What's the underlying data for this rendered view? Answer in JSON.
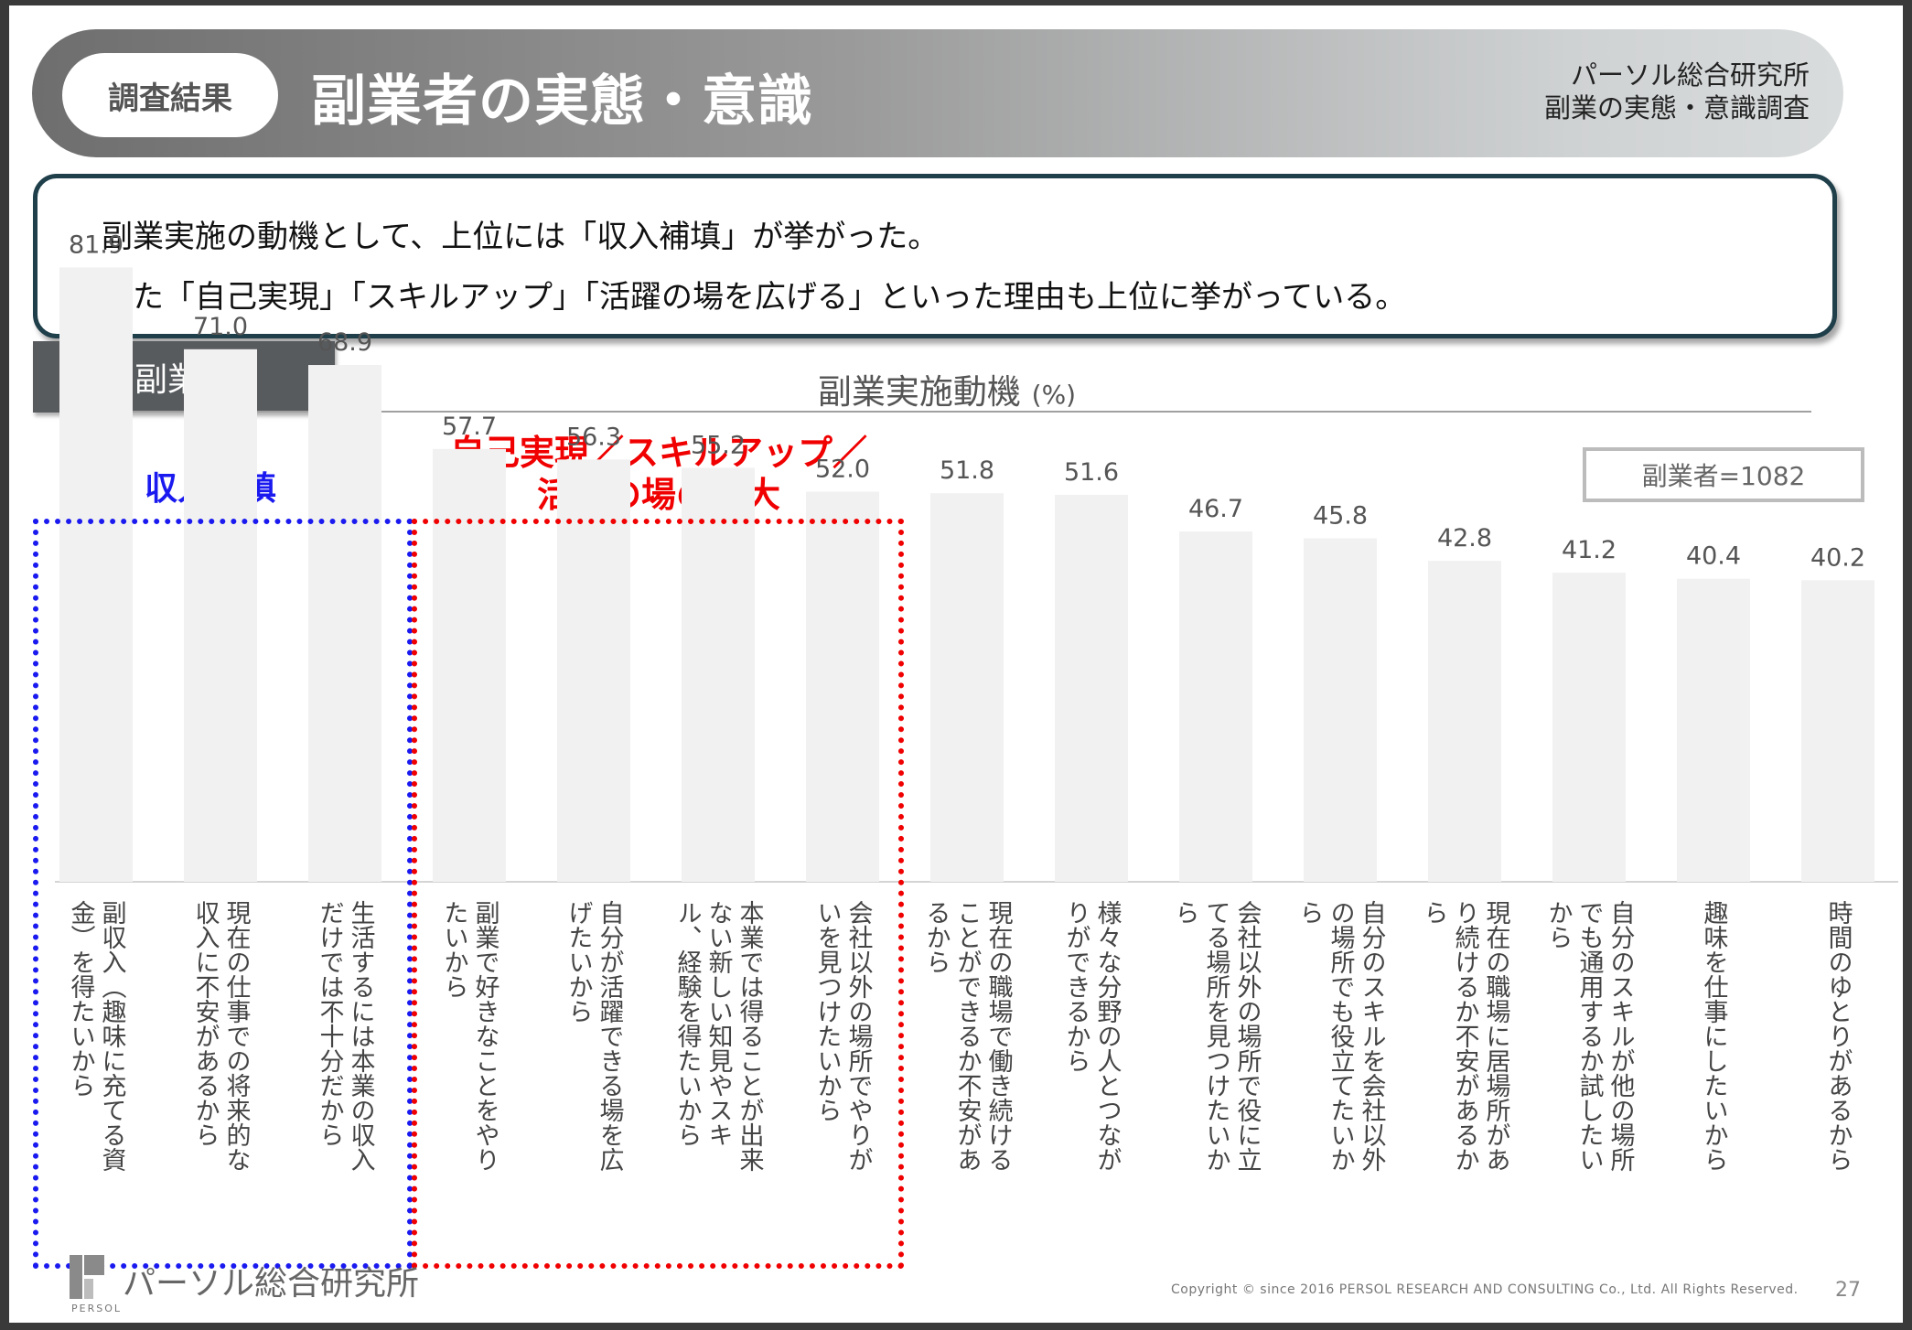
{
  "header": {
    "tag": "調査結果",
    "title": "副業者の実態・意識",
    "source_line1": "パーソル総合研究所",
    "source_line2": "副業の実態・意識調査"
  },
  "summary": {
    "line1": "副業実施の動機として、上位には「収入補填」が挙がった。",
    "line2": "また「自己実現」「スキルアップ」「活躍の場を広げる」といった理由も上位に挙がっている。"
  },
  "segment": "副業者",
  "sample": "副業者=1082",
  "groups": {
    "income": "収入補填",
    "self_line1": "自己実現／スキルアップ／",
    "self_line2": "活躍の場の拡大"
  },
  "colors": {
    "bar": "#f1f1f1",
    "income_group": "#1a1af0",
    "self_group": "#f00000"
  },
  "chart_data": {
    "type": "bar",
    "title": "副業実施動機",
    "unit": "(%)",
    "categories": [
      [
        "副収入（趣味に充てる資",
        "金）を得たいから"
      ],
      [
        "現在の仕事での将来的な",
        "収入に不安があるから"
      ],
      [
        "生活するには本業の収入",
        "だけでは不十分だから"
      ],
      [
        "副業で好きなことをやり",
        "たいから"
      ],
      [
        "自分が活躍できる場を広",
        "げたいから"
      ],
      [
        "本業では得ることが出来",
        "ない新しい知見やスキ",
        "ル、経験を得たいから"
      ],
      [
        "会社以外の場所でやりが",
        "いを見つけたいから"
      ],
      [
        "現在の職場で働き続ける",
        "ことができるか不安があ",
        "るから"
      ],
      [
        "様々な分野の人とつなが",
        "りができるから"
      ],
      [
        "会社以外の場所で役に立",
        "てる場所を見つけたいか",
        "ら"
      ],
      [
        "自分のスキルを会社以外",
        "の場所でも役立てたいか",
        "ら"
      ],
      [
        "現在の職場に居場所があ",
        "り続けるか不安があるか",
        "ら"
      ],
      [
        "自分のスキルが他の場所",
        "でも通用するか試したい",
        "から"
      ],
      [
        "趣味を仕事にしたいから"
      ],
      [
        "時間のゆとりがあるから"
      ]
    ],
    "values": [
      81.9,
      71.0,
      68.9,
      57.7,
      56.3,
      55.2,
      52.0,
      51.8,
      51.6,
      46.7,
      45.8,
      42.8,
      41.2,
      40.4,
      40.2
    ],
    "value_labels": [
      "81.9",
      "71.0",
      "68.9",
      "57.7",
      "56.3",
      "55.2",
      "52.0",
      "51.8",
      "51.6",
      "46.7",
      "45.8",
      "42.8",
      "41.2",
      "40.4",
      "40.2"
    ],
    "ylim": [
      0,
      100
    ],
    "grid": false,
    "legend": "none"
  },
  "footer": {
    "logo_text": "パーソル総合研究所",
    "logo_sub": "PERSOL",
    "copyright": "Copyright © since 2016 PERSOL RESEARCH AND CONSULTING Co., Ltd. All Rights Reserved.",
    "page": "27"
  }
}
